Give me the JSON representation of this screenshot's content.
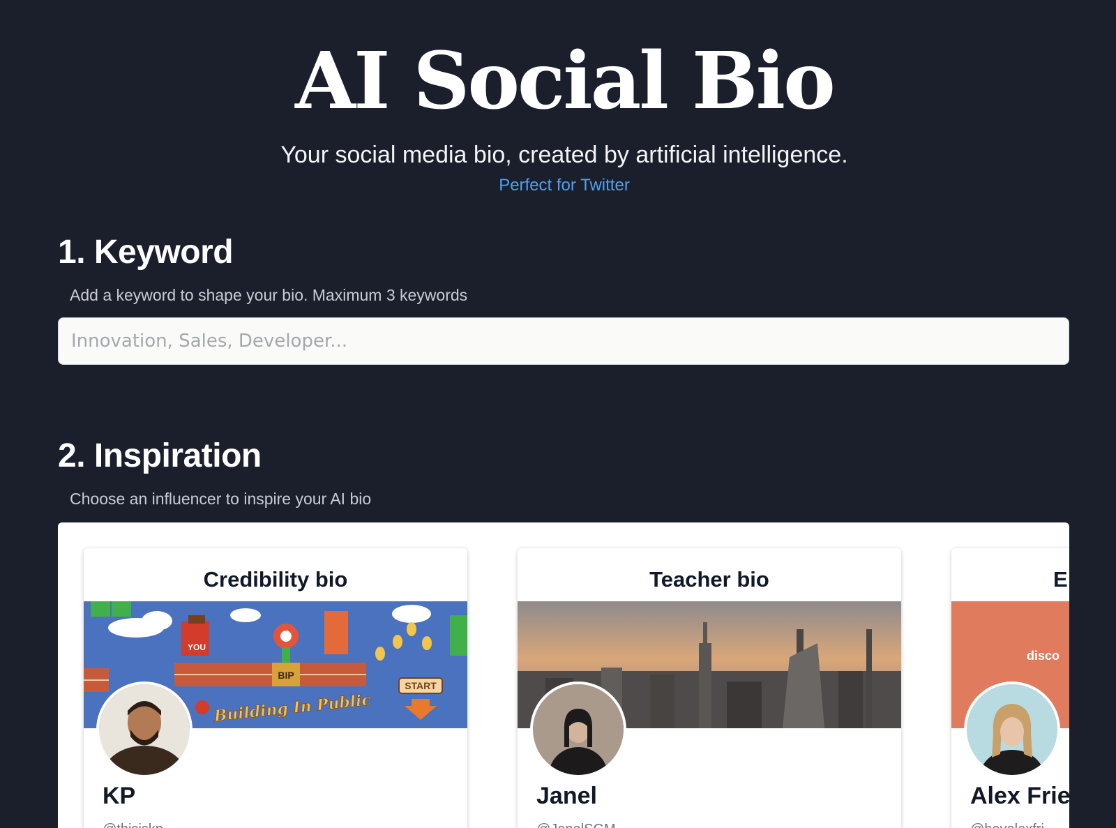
{
  "header": {
    "title": "AI Social Bio",
    "subtitle": "Your social media bio, created by artificial intelligence.",
    "link_label": "Perfect for Twitter"
  },
  "keyword_section": {
    "title": "1. Keyword",
    "hint": "Add a keyword to shape your bio. Maximum 3 keywords",
    "input_placeholder": "Innovation, Sales, Developer...",
    "input_value": ""
  },
  "inspiration_section": {
    "title": "2. Inspiration",
    "hint": "Choose an influencer to inspire your AI bio",
    "cards": [
      {
        "title": "Credibility bio",
        "name": "KP",
        "handle": "@thisiskp_",
        "banner_text": [
          "YOU",
          "BIP",
          "START",
          "Building In Public"
        ],
        "banner_color": "#4b72be"
      },
      {
        "title": "Teacher bio",
        "name": "Janel",
        "handle": "@JanelSGM",
        "banner_color": "#c79a74"
      },
      {
        "title": "E",
        "name": "Alex Frie",
        "handle": "@heyalexfri",
        "banner_text": [
          "disco"
        ],
        "banner_color": "#e07b5e"
      }
    ]
  },
  "colors": {
    "background": "#1a1f2b",
    "link": "#4ea1f0",
    "card_text": "#111827"
  }
}
